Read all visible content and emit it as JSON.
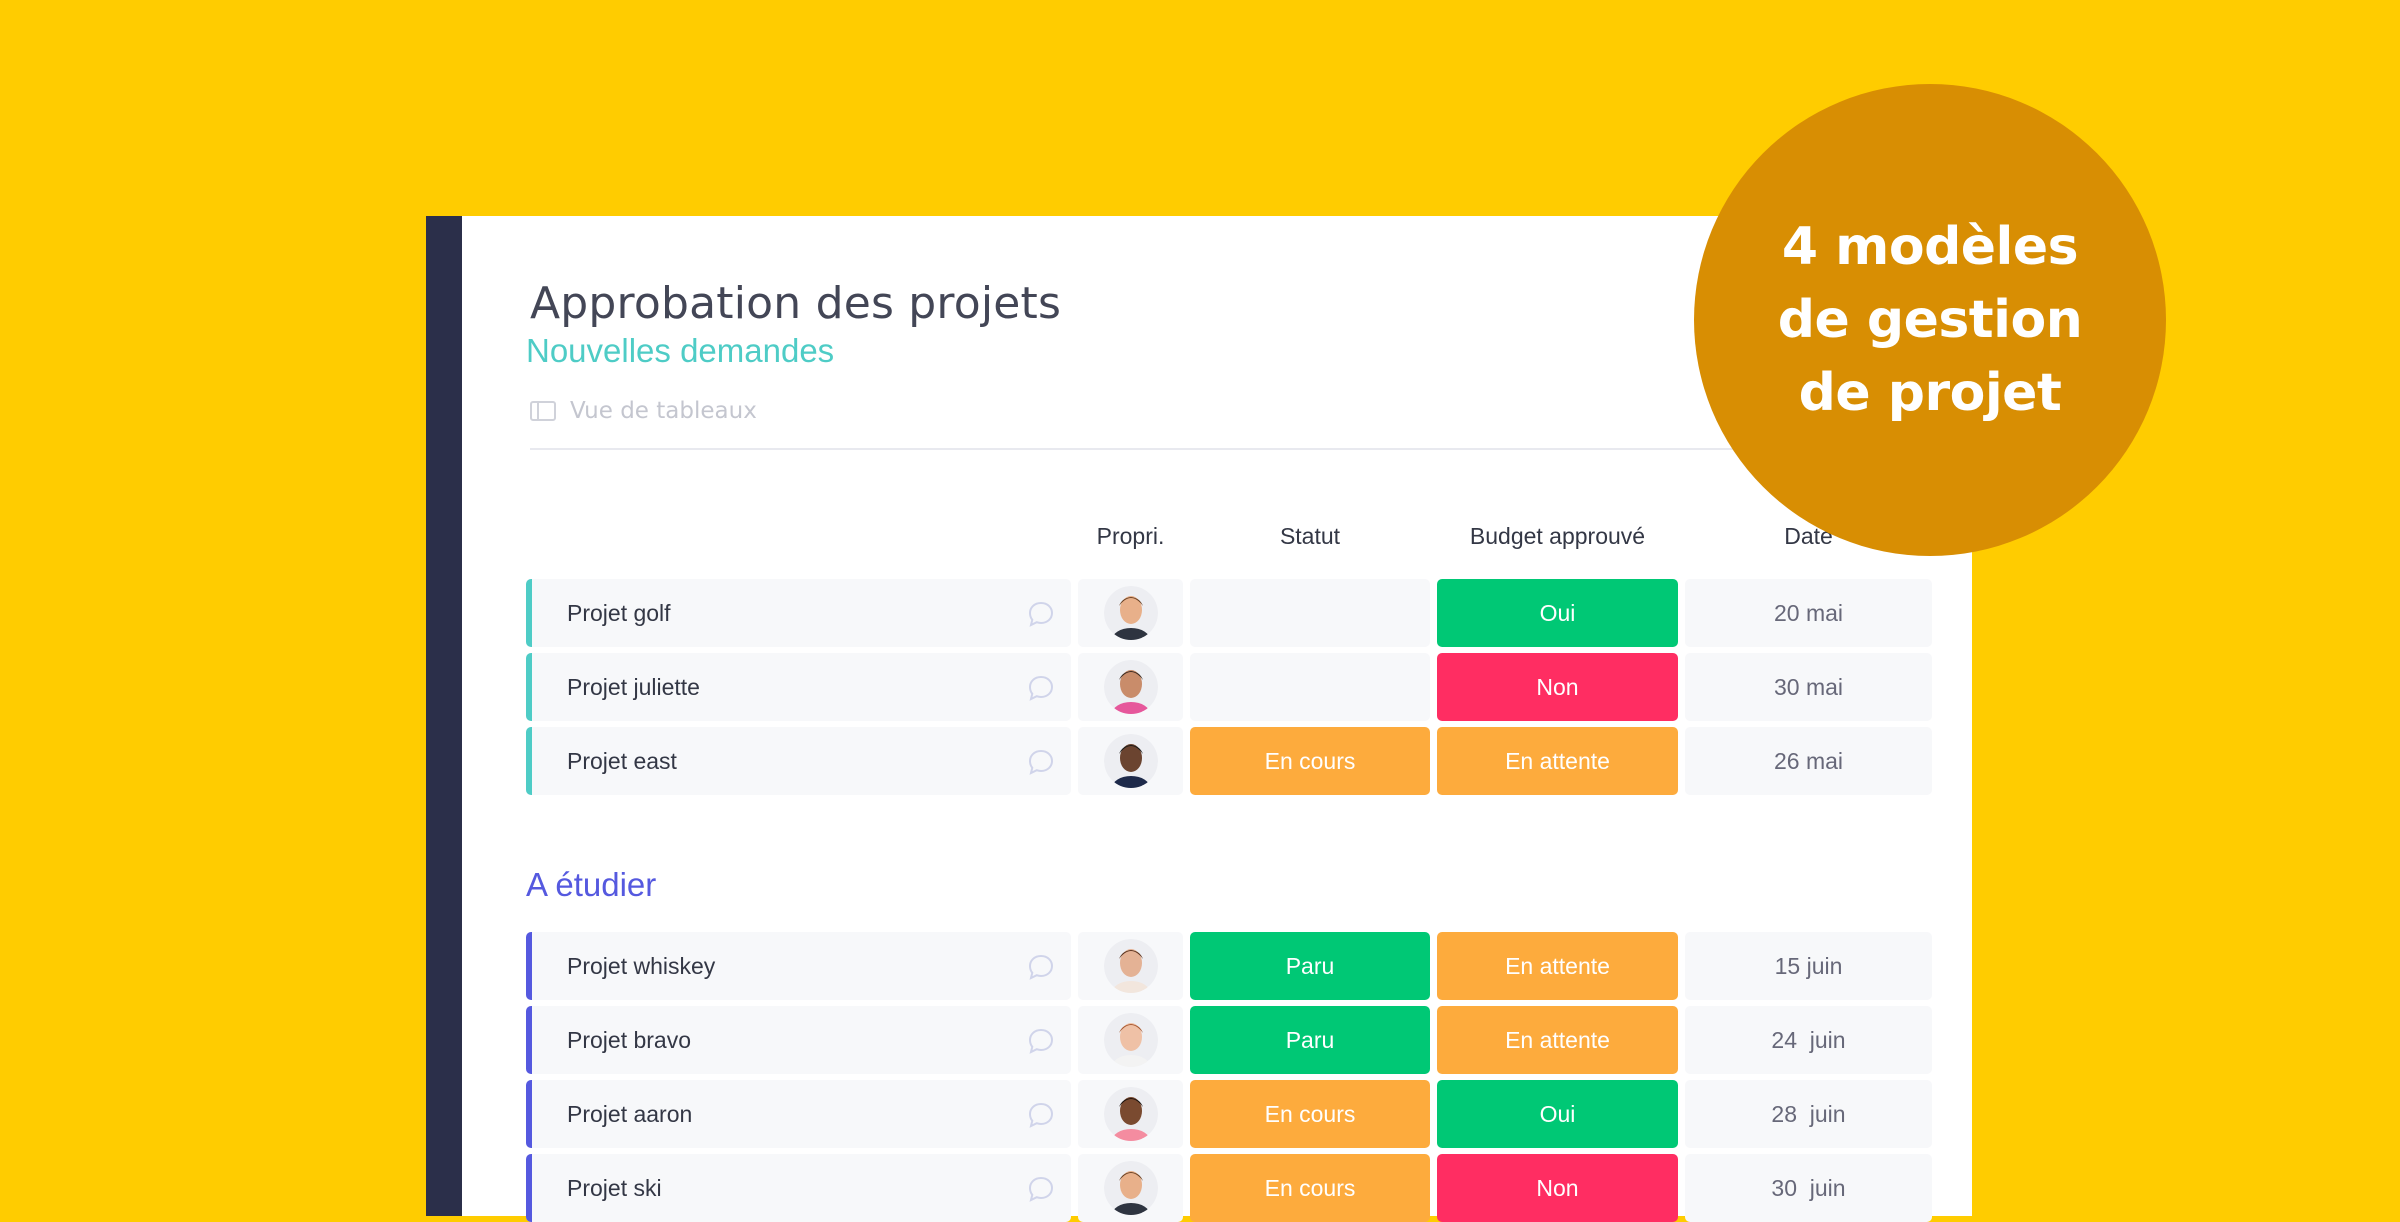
{
  "board": {
    "title": "Approbation des projets",
    "view_tab": {
      "label": "Vue de tableaux",
      "icon": "table-view-icon"
    }
  },
  "columns": {
    "owner": "Propri.",
    "status": "Statut",
    "budget": "Budget approuvé",
    "date": "Date"
  },
  "colors": {
    "background": "#FFCC00",
    "sidebar": "#2B2F4A",
    "badge": "#D88E03",
    "green": "#00C875",
    "red": "#FF2D62",
    "orange": "#FDAB3D",
    "group_teal": "#4ECCC6",
    "group_purple": "#5559DF"
  },
  "groups": [
    {
      "title": "Nouvelles demandes",
      "color": "#4ECCC6",
      "rows": [
        {
          "name": "Projet golf",
          "owner": "avatar-man-beard",
          "status": "",
          "status_color": "",
          "budget": "Oui",
          "budget_color": "#00C875",
          "date": "20 mai"
        },
        {
          "name": "Projet juliette",
          "owner": "avatar-man-floral-shirt",
          "status": "",
          "status_color": "",
          "budget": "Non",
          "budget_color": "#FF2D62",
          "date": "30 mai"
        },
        {
          "name": "Projet east",
          "owner": "avatar-man-glasses",
          "status": "En cours",
          "status_color": "#FDAB3D",
          "budget": "En attente",
          "budget_color": "#FDAB3D",
          "date": "26 mai"
        }
      ]
    },
    {
      "title": "A étudier",
      "color": "#5559DF",
      "rows": [
        {
          "name": "Projet whiskey",
          "owner": "avatar-woman-brown-hair",
          "status": "Paru",
          "status_color": "#00C875",
          "budget": "En attente",
          "budget_color": "#FDAB3D",
          "date": "15 juin"
        },
        {
          "name": "Projet bravo",
          "owner": "avatar-woman-red-hair",
          "status": "Paru",
          "status_color": "#00C875",
          "budget": "En attente",
          "budget_color": "#FDAB3D",
          "date": "24  juin"
        },
        {
          "name": "Projet aaron",
          "owner": "avatar-man-smiling",
          "status": "En cours",
          "status_color": "#FDAB3D",
          "budget": "Oui",
          "budget_color": "#00C875",
          "date": "28  juin"
        },
        {
          "name": "Projet ski",
          "owner": "avatar-man-beard",
          "status": "En cours",
          "status_color": "#FDAB3D",
          "budget": "Non",
          "budget_color": "#FF2D62",
          "date": "30  juin"
        }
      ]
    }
  ],
  "badge": {
    "lines": [
      "4 modèles",
      "de gestion",
      "de projet"
    ]
  }
}
